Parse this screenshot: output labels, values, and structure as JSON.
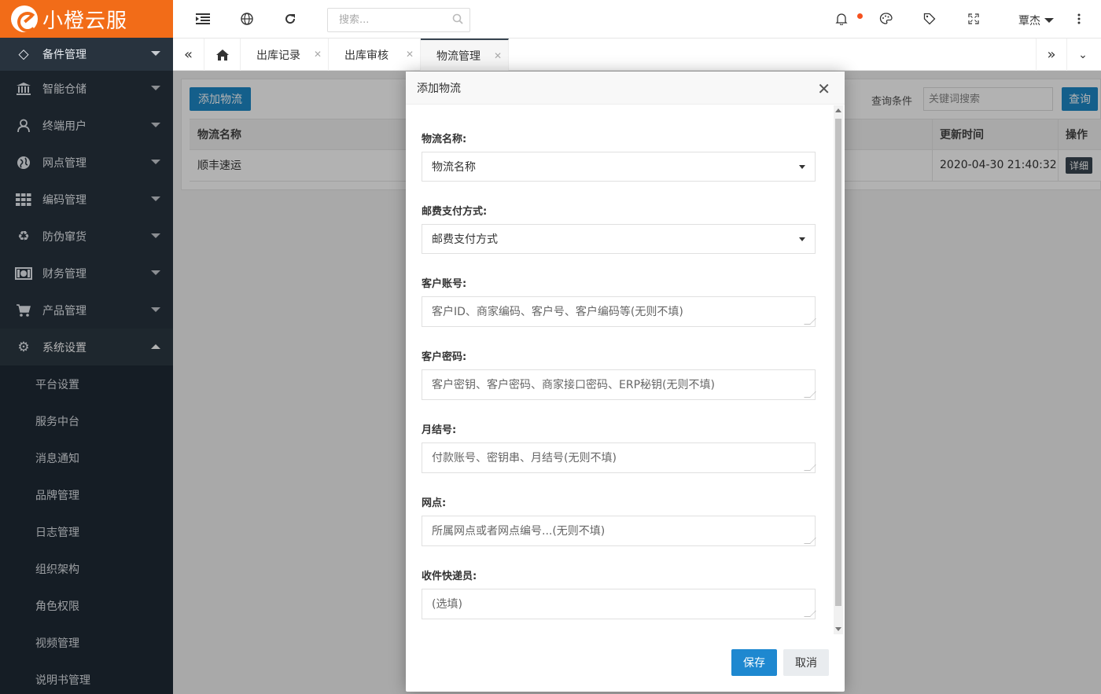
{
  "app": {
    "logo_text": "小橙云服"
  },
  "header": {
    "search_placeholder": "搜索...",
    "user_name": "覃杰"
  },
  "sidebar": {
    "items": [
      {
        "label": "备件管理",
        "icon": "diamond-icon"
      },
      {
        "label": "智能仓储",
        "icon": "bank-icon"
      },
      {
        "label": "终端用户",
        "icon": "user-icon"
      },
      {
        "label": "网点管理",
        "icon": "globe-icon"
      },
      {
        "label": "编码管理",
        "icon": "grid-icon"
      },
      {
        "label": "防伪窜货",
        "icon": "recycle-icon"
      },
      {
        "label": "财务管理",
        "icon": "money-icon"
      },
      {
        "label": "产品管理",
        "icon": "cart-icon"
      },
      {
        "label": "系统设置",
        "icon": "gear-icon"
      }
    ],
    "submenu": [
      "平台设置",
      "服务中台",
      "消息通知",
      "品牌管理",
      "日志管理",
      "组织架构",
      "角色权限",
      "视频管理",
      "说明书管理"
    ]
  },
  "tabs": [
    {
      "label": "出库记录"
    },
    {
      "label": "出库审核"
    },
    {
      "label": "物流管理"
    }
  ],
  "page": {
    "add_button": "添加物流",
    "query_label": "查询条件",
    "query_placeholder": "关键词搜索",
    "query_button": "查询",
    "columns": [
      "物流名称",
      "更新时间",
      "操作"
    ],
    "rows": [
      {
        "name": "顺丰速运",
        "updated": "2020-04-30 21:40:32",
        "action": "详细"
      }
    ]
  },
  "modal": {
    "title": "添加物流",
    "fields": [
      {
        "label": "物流名称:",
        "type": "select",
        "value": "物流名称"
      },
      {
        "label": "邮费支付方式:",
        "type": "select",
        "value": "邮费支付方式"
      },
      {
        "label": "客户账号:",
        "type": "textarea",
        "placeholder": "客户ID、商家编码、客户号、客户编码等(无则不填)"
      },
      {
        "label": "客户密码:",
        "type": "textarea",
        "placeholder": "客户密钥、客户密码、商家接口密码、ERP秘钥(无则不填)"
      },
      {
        "label": "月结号:",
        "type": "textarea",
        "placeholder": "付款账号、密钥串、月结号(无则不填)"
      },
      {
        "label": "网点:",
        "type": "textarea",
        "placeholder": "所属网点或者网点编号...(无则不填)"
      },
      {
        "label": "收件快递员:",
        "type": "textarea",
        "placeholder": "(选填)"
      }
    ],
    "save_button": "保存",
    "cancel_button": "取消"
  },
  "colors": {
    "accent": "#1e88c7",
    "brand": "#f26c18",
    "sidebar": "#28333e"
  }
}
